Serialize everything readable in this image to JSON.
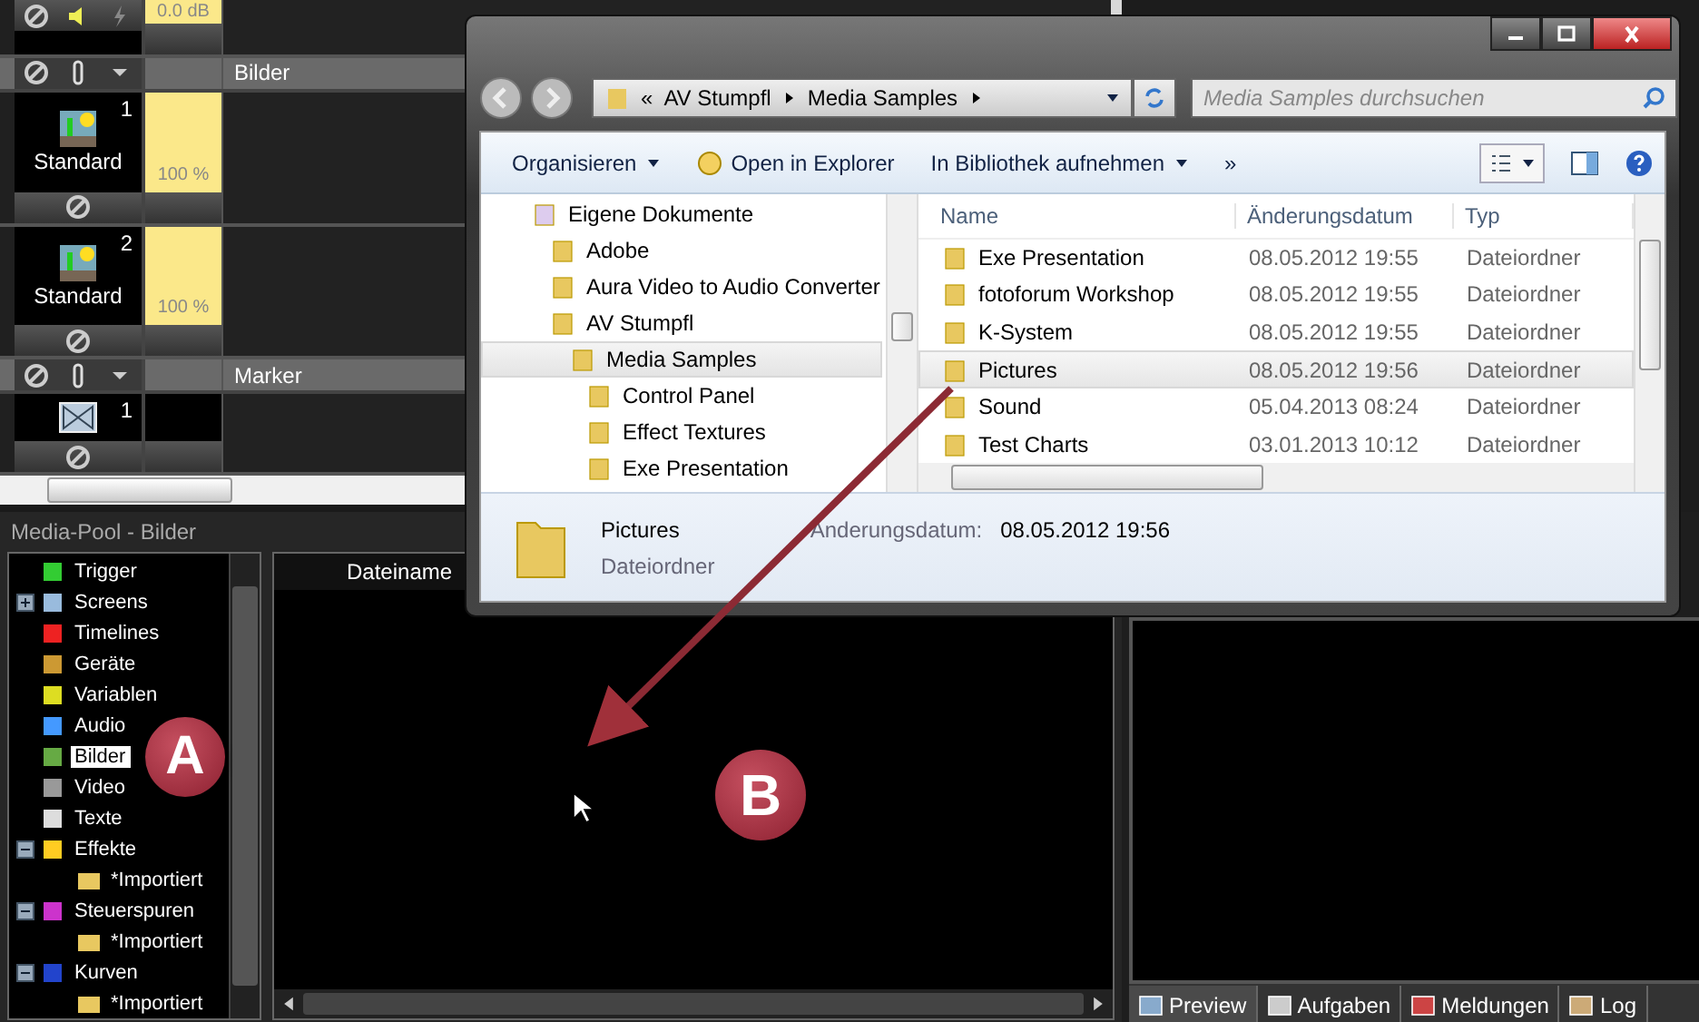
{
  "timeline": {
    "top_track": {
      "reading": "0.0 dB"
    },
    "groups": [
      {
        "title": "Bilder",
        "items": [
          {
            "kind": "image",
            "number": "1",
            "label": "Standard",
            "reading": "100 %"
          },
          {
            "kind": "image",
            "number": "2",
            "label": "Standard",
            "reading": "100 %"
          }
        ]
      },
      {
        "title": "Marker",
        "items": [
          {
            "kind": "marker",
            "number": "1"
          }
        ]
      }
    ]
  },
  "media_pool": {
    "title": "Media-Pool - Bilder",
    "columns": [
      "Dateiname"
    ],
    "tree": [
      {
        "kind": "trigger",
        "label": "Trigger",
        "selected": false
      },
      {
        "kind": "screens",
        "label": "Screens",
        "selected": false,
        "expanded": false
      },
      {
        "kind": "timelines",
        "label": "Timelines",
        "selected": false
      },
      {
        "kind": "devices",
        "label": "Geräte",
        "selected": false
      },
      {
        "kind": "variables",
        "label": "Variablen",
        "selected": false
      },
      {
        "kind": "audio",
        "label": "Audio",
        "selected": false
      },
      {
        "kind": "images",
        "label": "Bilder",
        "selected": true
      },
      {
        "kind": "video",
        "label": "Video",
        "selected": false
      },
      {
        "kind": "texts",
        "label": "Texte",
        "selected": false
      },
      {
        "kind": "effects",
        "label": "Effekte",
        "selected": false,
        "expanded": true,
        "children": [
          {
            "kind": "folder",
            "label": "*Importiert",
            "selected": false
          }
        ]
      },
      {
        "kind": "control",
        "label": "Steuerspuren",
        "selected": false,
        "expanded": true,
        "children": [
          {
            "kind": "folder",
            "label": "*Importiert",
            "selected": false
          }
        ]
      },
      {
        "kind": "curves",
        "label": "Kurven",
        "selected": false,
        "expanded": true,
        "children": [
          {
            "kind": "folder",
            "label": "*Importiert",
            "selected": false
          }
        ]
      }
    ]
  },
  "explorer": {
    "breadcrumbs": [
      "«",
      "AV Stumpfl",
      "Media Samples"
    ],
    "search": {
      "placeholder": "Media Samples durchsuchen"
    },
    "toolbar": [
      {
        "label": "Organisieren",
        "dropdown": true,
        "kind": "menu"
      },
      {
        "label": "Open in Explorer",
        "dropdown": false,
        "kind": "open"
      },
      {
        "label": "In Bibliothek aufnehmen",
        "dropdown": true,
        "kind": "menu"
      }
    ],
    "more": "»",
    "nav_tree": [
      {
        "kind": "documents",
        "label": "Eigene Dokumente",
        "selected": false,
        "children": [
          {
            "kind": "folder",
            "label": "Adobe",
            "selected": false
          },
          {
            "kind": "folder",
            "label": "Aura Video to Audio Converter",
            "selected": false
          },
          {
            "kind": "folder",
            "label": "AV Stumpfl",
            "selected": false,
            "children": [
              {
                "kind": "folder",
                "label": "Media Samples",
                "selected": true,
                "children": [
                  {
                    "kind": "folder",
                    "label": "Control Panel",
                    "selected": false
                  },
                  {
                    "kind": "folder",
                    "label": "Effect Textures",
                    "selected": false
                  },
                  {
                    "kind": "folder",
                    "label": "Exe Presentation",
                    "selected": false
                  }
                ]
              }
            ]
          }
        ]
      }
    ],
    "columns": [
      "Name",
      "Änderungsdatum",
      "Typ"
    ],
    "rows": [
      {
        "name": "Exe Presentation",
        "date": "08.05.2012 19:55",
        "type": "Dateiordner",
        "selected": false
      },
      {
        "name": "fotoforum Workshop",
        "date": "08.05.2012 19:55",
        "type": "Dateiordner",
        "selected": false
      },
      {
        "name": "K-System",
        "date": "08.05.2012 19:55",
        "type": "Dateiordner",
        "selected": false
      },
      {
        "name": "Pictures",
        "date": "08.05.2012 19:56",
        "type": "Dateiordner",
        "selected": true
      },
      {
        "name": "Sound",
        "date": "05.04.2013 08:24",
        "type": "Dateiordner",
        "selected": false
      },
      {
        "name": "Test Charts",
        "date": "03.01.2013 10:12",
        "type": "Dateiordner",
        "selected": false
      }
    ],
    "details": {
      "name": "Pictures",
      "date_label": "Änderungsdatum:",
      "date": "08.05.2012 19:56",
      "type": "Dateiordner"
    }
  },
  "preview_tabs": [
    {
      "kind": "preview",
      "label": "Preview",
      "selected": true
    },
    {
      "kind": "tasks",
      "label": "Aufgaben",
      "selected": false
    },
    {
      "kind": "messages",
      "label": "Meldungen",
      "selected": false
    },
    {
      "kind": "log",
      "label": "Log",
      "selected": false
    }
  ],
  "annotations": [
    {
      "label": "A"
    },
    {
      "label": "B"
    }
  ]
}
